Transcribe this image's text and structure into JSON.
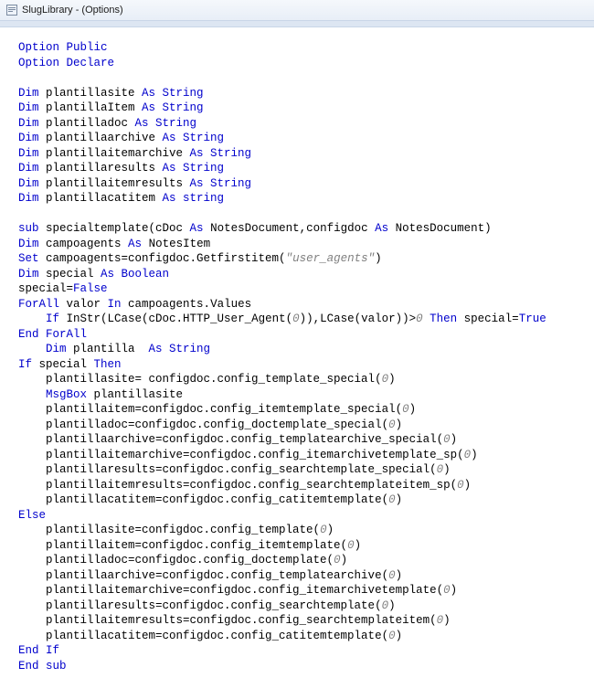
{
  "window": {
    "title": "SlugLibrary - (Options)"
  },
  "code": {
    "tokens": [
      [
        {
          "c": "kw",
          "t": "Option"
        },
        {
          "c": "",
          "t": " "
        },
        {
          "c": "kw",
          "t": "Public"
        }
      ],
      [
        {
          "c": "kw",
          "t": "Option"
        },
        {
          "c": "",
          "t": " "
        },
        {
          "c": "kw",
          "t": "Declare"
        }
      ],
      [],
      [
        {
          "c": "kw",
          "t": "Dim"
        },
        {
          "c": "",
          "t": " plantillasite "
        },
        {
          "c": "kw",
          "t": "As String"
        }
      ],
      [
        {
          "c": "kw",
          "t": "Dim"
        },
        {
          "c": "",
          "t": " plantillaItem "
        },
        {
          "c": "kw",
          "t": "As String"
        }
      ],
      [
        {
          "c": "kw",
          "t": "Dim"
        },
        {
          "c": "",
          "t": " plantilladoc "
        },
        {
          "c": "kw",
          "t": "As String"
        }
      ],
      [
        {
          "c": "kw",
          "t": "Dim"
        },
        {
          "c": "",
          "t": " plantillaarchive "
        },
        {
          "c": "kw",
          "t": "As String"
        }
      ],
      [
        {
          "c": "kw",
          "t": "Dim"
        },
        {
          "c": "",
          "t": " plantillaitemarchive "
        },
        {
          "c": "kw",
          "t": "As String"
        }
      ],
      [
        {
          "c": "kw",
          "t": "Dim"
        },
        {
          "c": "",
          "t": " plantillaresults "
        },
        {
          "c": "kw",
          "t": "As String"
        }
      ],
      [
        {
          "c": "kw",
          "t": "Dim"
        },
        {
          "c": "",
          "t": " plantillaitemresults "
        },
        {
          "c": "kw",
          "t": "As String"
        }
      ],
      [
        {
          "c": "kw",
          "t": "Dim"
        },
        {
          "c": "",
          "t": " plantillacatitem "
        },
        {
          "c": "kw",
          "t": "As string"
        }
      ],
      [],
      [
        {
          "c": "kw",
          "t": "sub"
        },
        {
          "c": "",
          "t": " specialtemplate(cDoc "
        },
        {
          "c": "kw",
          "t": "As"
        },
        {
          "c": "",
          "t": " NotesDocument,configdoc "
        },
        {
          "c": "kw",
          "t": "As"
        },
        {
          "c": "",
          "t": " NotesDocument)"
        }
      ],
      [
        {
          "c": "kw",
          "t": "Dim"
        },
        {
          "c": "",
          "t": " campoagents "
        },
        {
          "c": "kw",
          "t": "As"
        },
        {
          "c": "",
          "t": " NotesItem"
        }
      ],
      [
        {
          "c": "kw",
          "t": "Set"
        },
        {
          "c": "",
          "t": " campoagents=configdoc.Getfirstitem("
        },
        {
          "c": "str",
          "t": "\"user_agents\""
        },
        {
          "c": "",
          "t": ")"
        }
      ],
      [
        {
          "c": "kw",
          "t": "Dim"
        },
        {
          "c": "",
          "t": " special "
        },
        {
          "c": "kw",
          "t": "As Boolean"
        }
      ],
      [
        {
          "c": "",
          "t": "special="
        },
        {
          "c": "kw",
          "t": "False"
        }
      ],
      [
        {
          "c": "kw",
          "t": "ForAll"
        },
        {
          "c": "",
          "t": " valor "
        },
        {
          "c": "kw",
          "t": "In"
        },
        {
          "c": "",
          "t": " campoagents.Values"
        }
      ],
      [
        {
          "c": "",
          "t": "    "
        },
        {
          "c": "kw",
          "t": "If"
        },
        {
          "c": "",
          "t": " InStr(LCase(cDoc.HTTP_User_Agent("
        },
        {
          "c": "num",
          "t": "0"
        },
        {
          "c": "",
          "t": ")),LCase(valor))>"
        },
        {
          "c": "num",
          "t": "0"
        },
        {
          "c": "",
          "t": " "
        },
        {
          "c": "kw",
          "t": "Then"
        },
        {
          "c": "",
          "t": " special="
        },
        {
          "c": "kw",
          "t": "True"
        }
      ],
      [
        {
          "c": "kw",
          "t": "End ForAll"
        }
      ],
      [
        {
          "c": "",
          "t": "    "
        },
        {
          "c": "kw",
          "t": "Dim"
        },
        {
          "c": "",
          "t": " plantilla  "
        },
        {
          "c": "kw",
          "t": "As String"
        }
      ],
      [
        {
          "c": "kw",
          "t": "If"
        },
        {
          "c": "",
          "t": " special "
        },
        {
          "c": "kw",
          "t": "Then"
        }
      ],
      [
        {
          "c": "",
          "t": "    plantillasite= configdoc.config_template_special("
        },
        {
          "c": "num",
          "t": "0"
        },
        {
          "c": "",
          "t": ")"
        }
      ],
      [
        {
          "c": "",
          "t": "    "
        },
        {
          "c": "kw",
          "t": "MsgBox"
        },
        {
          "c": "",
          "t": " plantillasite"
        }
      ],
      [
        {
          "c": "",
          "t": "    plantillaitem=configdoc.config_itemtemplate_special("
        },
        {
          "c": "num",
          "t": "0"
        },
        {
          "c": "",
          "t": ")"
        }
      ],
      [
        {
          "c": "",
          "t": "    plantilladoc=configdoc.config_doctemplate_special("
        },
        {
          "c": "num",
          "t": "0"
        },
        {
          "c": "",
          "t": ")"
        }
      ],
      [
        {
          "c": "",
          "t": "    plantillaarchive=configdoc.config_templatearchive_special("
        },
        {
          "c": "num",
          "t": "0"
        },
        {
          "c": "",
          "t": ")"
        }
      ],
      [
        {
          "c": "",
          "t": "    plantillaitemarchive=configdoc.config_itemarchivetemplate_sp("
        },
        {
          "c": "num",
          "t": "0"
        },
        {
          "c": "",
          "t": ")"
        }
      ],
      [
        {
          "c": "",
          "t": "    plantillaresults=configdoc.config_searchtemplate_special("
        },
        {
          "c": "num",
          "t": "0"
        },
        {
          "c": "",
          "t": ")"
        }
      ],
      [
        {
          "c": "",
          "t": "    plantillaitemresults=configdoc.config_searchtemplateitem_sp("
        },
        {
          "c": "num",
          "t": "0"
        },
        {
          "c": "",
          "t": ")"
        }
      ],
      [
        {
          "c": "",
          "t": "    plantillacatitem=configdoc.config_catitemtemplate("
        },
        {
          "c": "num",
          "t": "0"
        },
        {
          "c": "",
          "t": ")"
        }
      ],
      [
        {
          "c": "kw",
          "t": "Else"
        }
      ],
      [
        {
          "c": "",
          "t": "    plantillasite=configdoc.config_template("
        },
        {
          "c": "num",
          "t": "0"
        },
        {
          "c": "",
          "t": ")"
        }
      ],
      [
        {
          "c": "",
          "t": "    plantillaitem=configdoc.config_itemtemplate("
        },
        {
          "c": "num",
          "t": "0"
        },
        {
          "c": "",
          "t": ")"
        }
      ],
      [
        {
          "c": "",
          "t": "    plantilladoc=configdoc.config_doctemplate("
        },
        {
          "c": "num",
          "t": "0"
        },
        {
          "c": "",
          "t": ")"
        }
      ],
      [
        {
          "c": "",
          "t": "    plantillaarchive=configdoc.config_templatearchive("
        },
        {
          "c": "num",
          "t": "0"
        },
        {
          "c": "",
          "t": ")"
        }
      ],
      [
        {
          "c": "",
          "t": "    plantillaitemarchive=configdoc.config_itemarchivetemplate("
        },
        {
          "c": "num",
          "t": "0"
        },
        {
          "c": "",
          "t": ")"
        }
      ],
      [
        {
          "c": "",
          "t": "    plantillaresults=configdoc.config_searchtemplate("
        },
        {
          "c": "num",
          "t": "0"
        },
        {
          "c": "",
          "t": ")"
        }
      ],
      [
        {
          "c": "",
          "t": "    plantillaitemresults=configdoc.config_searchtemplateitem("
        },
        {
          "c": "num",
          "t": "0"
        },
        {
          "c": "",
          "t": ")"
        }
      ],
      [
        {
          "c": "",
          "t": "    plantillacatitem=configdoc.config_catitemtemplate("
        },
        {
          "c": "num",
          "t": "0"
        },
        {
          "c": "",
          "t": ")"
        }
      ],
      [
        {
          "c": "kw",
          "t": "End If"
        }
      ],
      [
        {
          "c": "kw",
          "t": "End sub"
        }
      ]
    ]
  }
}
